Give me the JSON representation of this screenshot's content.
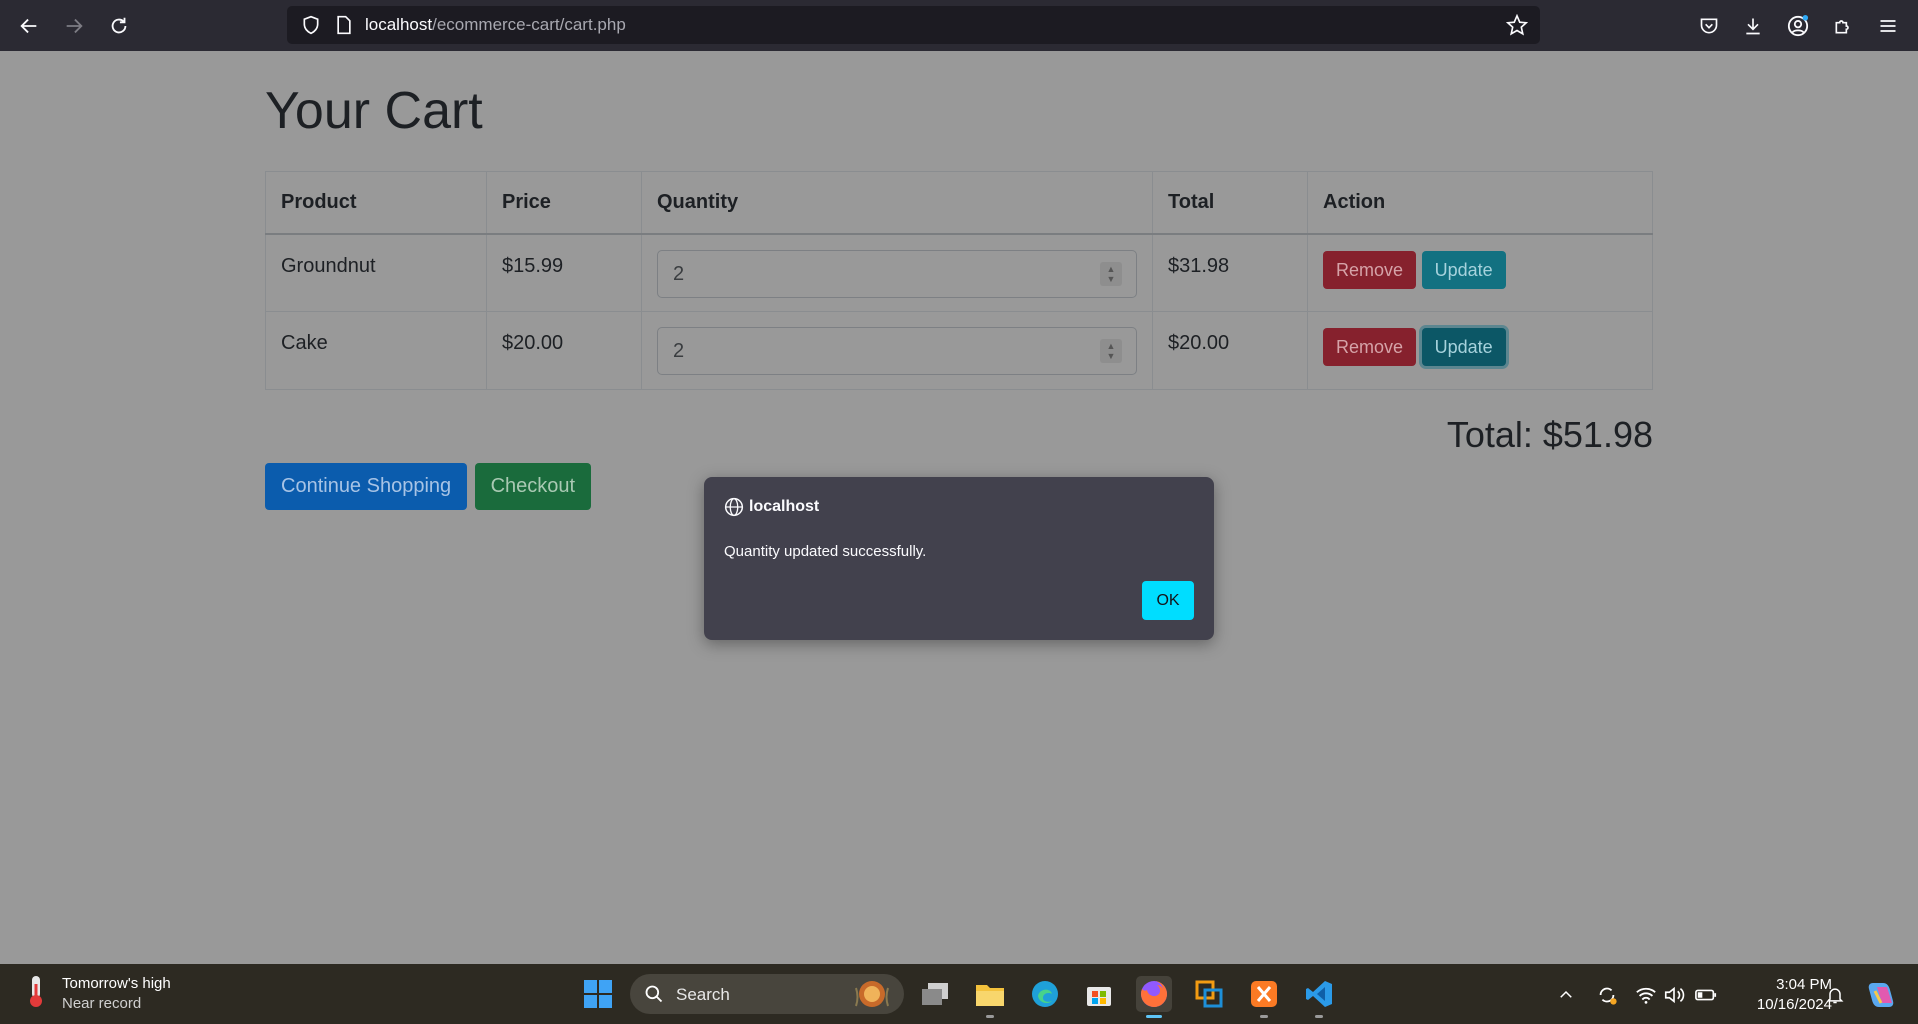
{
  "browser": {
    "url_host": "localhost",
    "url_path": "/ecommerce-cart/cart.php"
  },
  "page": {
    "title": "Your Cart",
    "table": {
      "headers": [
        "Product",
        "Price",
        "Quantity",
        "Total",
        "Action"
      ],
      "rows": [
        {
          "product": "Groundnut",
          "price": "$15.99",
          "quantity": "2",
          "total": "$31.98",
          "remove": "Remove",
          "update": "Update"
        },
        {
          "product": "Cake",
          "price": "$20.00",
          "quantity": "2",
          "total": "$20.00",
          "remove": "Remove",
          "update": "Update"
        }
      ]
    },
    "grand_total": "Total: $51.98",
    "continue_label": "Continue Shopping",
    "checkout_label": "Checkout"
  },
  "dialog": {
    "origin": "localhost",
    "message": "Quantity updated successfully.",
    "ok_label": "OK"
  },
  "taskbar": {
    "weather_title": "Tomorrow's high",
    "weather_sub": "Near record",
    "search_label": "Search",
    "time": "3:04 PM",
    "date": "10/16/2024"
  },
  "colors": {
    "accent_ok": "#00ddff",
    "danger": "#86212d",
    "info": "#127181",
    "primary": "#0b5cad",
    "success": "#1a6b3c"
  }
}
